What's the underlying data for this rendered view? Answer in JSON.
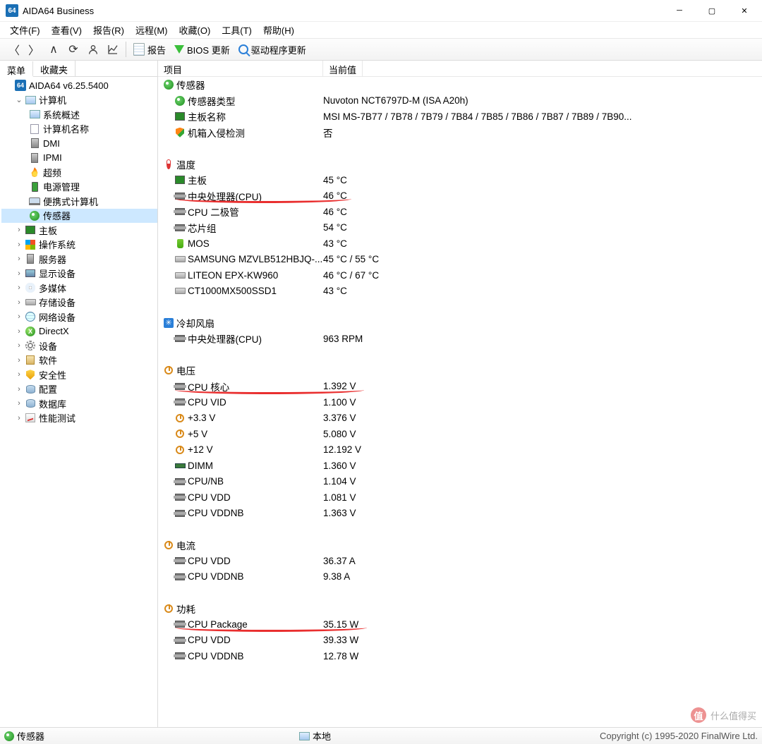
{
  "window": {
    "title": "AIDA64 Business",
    "icon": "64"
  },
  "menubar": [
    "文件(F)",
    "查看(V)",
    "报告(R)",
    "远程(M)",
    "收藏(O)",
    "工具(T)",
    "帮助(H)"
  ],
  "toolbar": {
    "report": "报告",
    "bios": "BIOS 更新",
    "driver": "驱动程序更新"
  },
  "tabs": {
    "menu": "菜单",
    "fav": "收藏夹"
  },
  "tree": {
    "root": "AIDA64 v6.25.5400",
    "computer": "计算机",
    "computer_children": [
      "系统概述",
      "计算机名称",
      "DMI",
      "IPMI",
      "超频",
      "电源管理",
      "便携式计算机",
      "传感器"
    ],
    "rest": [
      "主板",
      "操作系统",
      "服务器",
      "显示设备",
      "多媒体",
      "存储设备",
      "网络设备",
      "DirectX",
      "设备",
      "软件",
      "安全性",
      "配置",
      "数据库",
      "性能测试"
    ]
  },
  "listhdr": {
    "item": "项目",
    "value": "当前值"
  },
  "sections": {
    "sensor": {
      "title": "传感器",
      "rows": [
        {
          "icon": "sensor",
          "label": "传感器类型",
          "value": "Nuvoton NCT6797D-M  (ISA A20h)"
        },
        {
          "icon": "mb",
          "label": "主板名称",
          "value": "MSI MS-7B77 / 7B78 / 7B79 / 7B84 / 7B85 / 7B86 / 7B87 / 7B89 / 7B90..."
        },
        {
          "icon": "shield",
          "label": "机箱入侵检测",
          "value": "否"
        }
      ]
    },
    "temp": {
      "title": "温度",
      "rows": [
        {
          "icon": "mb",
          "label": "主板",
          "value": "45 °C"
        },
        {
          "icon": "chip",
          "label": "中央处理器(CPU)",
          "value": "46 °C"
        },
        {
          "icon": "chip",
          "label": "CPU 二极管",
          "value": "46 °C"
        },
        {
          "icon": "chip",
          "label": "芯片组",
          "value": "54 °C"
        },
        {
          "icon": "mos",
          "label": "MOS",
          "value": "43 °C"
        },
        {
          "icon": "ssd",
          "label": "SAMSUNG MZVLB512HBJQ-...",
          "value": "45 °C / 55 °C"
        },
        {
          "icon": "ssd",
          "label": "LITEON EPX-KW960",
          "value": "46 °C / 67 °C"
        },
        {
          "icon": "ssd",
          "label": "CT1000MX500SSD1",
          "value": "43 °C"
        }
      ]
    },
    "fan": {
      "title": "冷却风扇",
      "rows": [
        {
          "icon": "chip",
          "label": "中央处理器(CPU)",
          "value": "963 RPM"
        }
      ]
    },
    "volt": {
      "title": "电压",
      "rows": [
        {
          "icon": "chip",
          "label": "CPU 核心",
          "value": "1.392 V"
        },
        {
          "icon": "chip",
          "label": "CPU VID",
          "value": "1.100 V"
        },
        {
          "icon": "pow",
          "label": "+3.3 V",
          "value": "3.376 V"
        },
        {
          "icon": "pow",
          "label": "+5 V",
          "value": "5.080 V"
        },
        {
          "icon": "pow",
          "label": "+12 V",
          "value": "12.192 V"
        },
        {
          "icon": "dimm",
          "label": "DIMM",
          "value": "1.360 V"
        },
        {
          "icon": "chip",
          "label": "CPU/NB",
          "value": "1.104 V"
        },
        {
          "icon": "chip",
          "label": "CPU VDD",
          "value": "1.081 V"
        },
        {
          "icon": "chip",
          "label": "CPU VDDNB",
          "value": "1.363 V"
        }
      ]
    },
    "curr": {
      "title": "电流",
      "rows": [
        {
          "icon": "chip",
          "label": "CPU VDD",
          "value": "36.37 A"
        },
        {
          "icon": "chip",
          "label": "CPU VDDNB",
          "value": "9.38 A"
        }
      ]
    },
    "power": {
      "title": "功耗",
      "rows": [
        {
          "icon": "chip",
          "label": "CPU Package",
          "value": "35.15 W"
        },
        {
          "icon": "chip",
          "label": "CPU VDD",
          "value": "39.33 W"
        },
        {
          "icon": "chip",
          "label": "CPU VDDNB",
          "value": "12.78 W"
        }
      ]
    }
  },
  "status": {
    "left": "传感器",
    "mid": "本地",
    "copy": "Copyright (c) 1995-2020 FinalWire Ltd."
  },
  "watermark": "什么值得买"
}
